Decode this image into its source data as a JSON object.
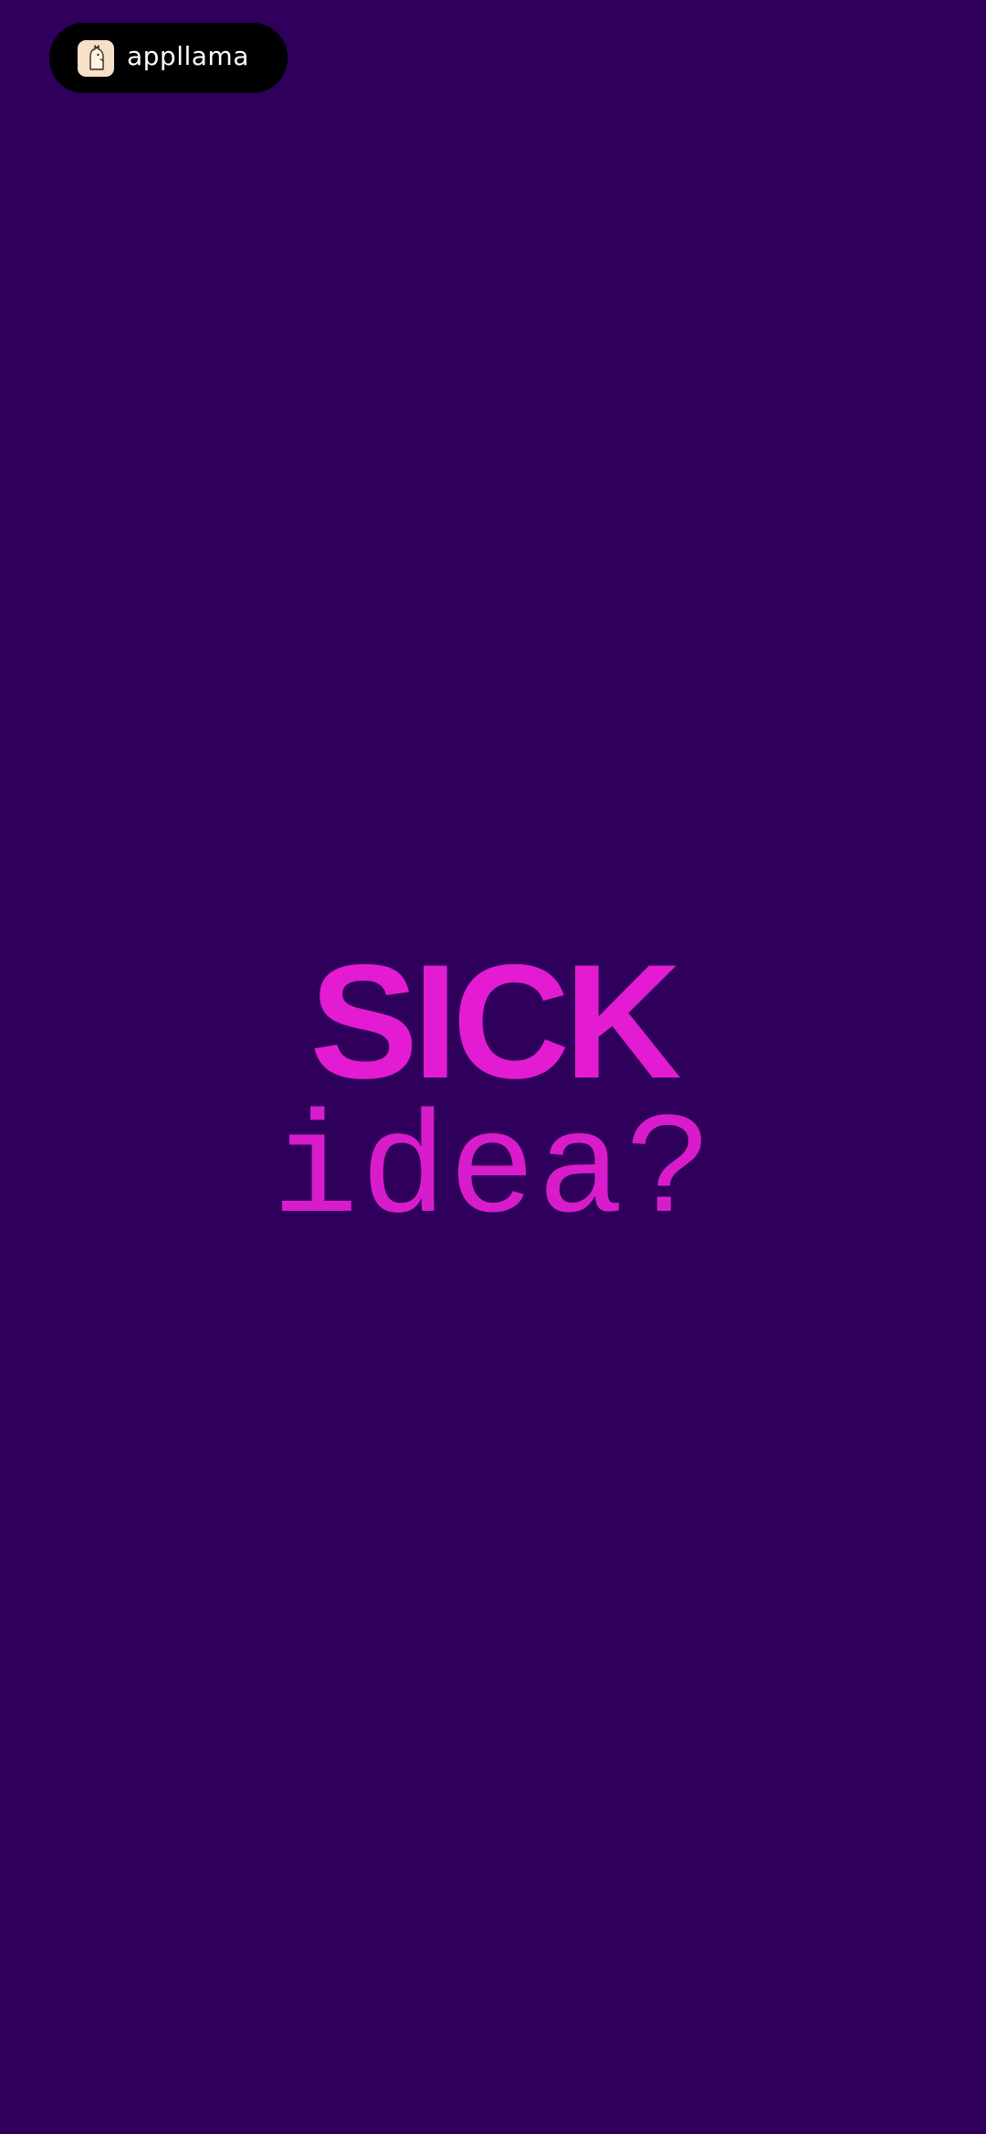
{
  "badge": {
    "logo_icon": "llama-icon",
    "brand_name": "appllama"
  },
  "main": {
    "headline": "SICK",
    "subline": "idea?"
  },
  "colors": {
    "background": "#2e005c",
    "accent": "#e31bd2",
    "badge_background": "#000000",
    "badge_logo_background": "#f6e1c6"
  }
}
